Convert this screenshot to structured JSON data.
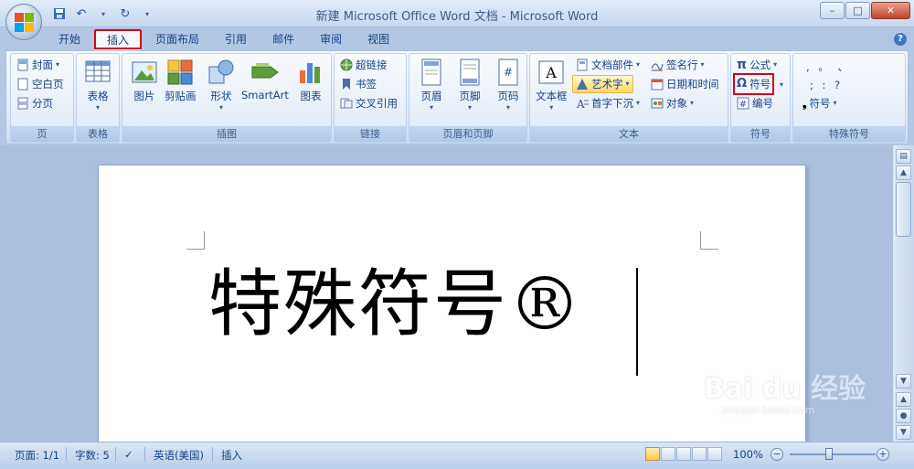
{
  "window": {
    "title": "新建 Microsoft Office Word 文档 - Microsoft Word",
    "minimize": "–",
    "maximize": "□",
    "close": "✕"
  },
  "tabs": [
    {
      "label": "开始"
    },
    {
      "label": "插入",
      "active": true
    },
    {
      "label": "页面布局"
    },
    {
      "label": "引用"
    },
    {
      "label": "邮件"
    },
    {
      "label": "审阅"
    },
    {
      "label": "视图"
    }
  ],
  "ribbon": {
    "pages": {
      "label": "页",
      "cover": "封面",
      "blank": "空白页",
      "break": "分页"
    },
    "tables": {
      "label": "表格",
      "table": "表格"
    },
    "illustrations": {
      "label": "插图",
      "picture": "图片",
      "clipart": "剪贴画",
      "shapes": "形状",
      "smartart": "SmartArt",
      "chart": "图表"
    },
    "links": {
      "label": "链接",
      "hyperlink": "超链接",
      "bookmark": "书签",
      "crossref": "交叉引用"
    },
    "header_footer": {
      "label": "页眉和页脚",
      "header": "页眉",
      "footer": "页脚",
      "page_number": "页码"
    },
    "text": {
      "label": "文本",
      "textbox": "文本框",
      "quick_parts": "文档部件",
      "wordart": "艺术字",
      "dropcap": "首字下沉",
      "signature": "签名行",
      "datetime": "日期和时间",
      "object": "对象"
    },
    "symbols": {
      "label": "符号",
      "equation": "公式",
      "symbol": "符号",
      "number": "编号"
    },
    "special": {
      "label": "特殊符号",
      "row1": ",  。  、",
      "row2": ";  :  ?",
      "symbol": "符号"
    }
  },
  "document": {
    "content": "特殊符号®"
  },
  "statusbar": {
    "page": "页面: 1/1",
    "words": "字数: 5",
    "language": "英语(美国)",
    "mode": "插入",
    "zoom": "100%"
  },
  "watermark": {
    "brand": "Bai du 经验",
    "url": "jingyan.baidu.com"
  },
  "colors": {
    "accent": "#15428b",
    "highlight": "#d6001c"
  }
}
